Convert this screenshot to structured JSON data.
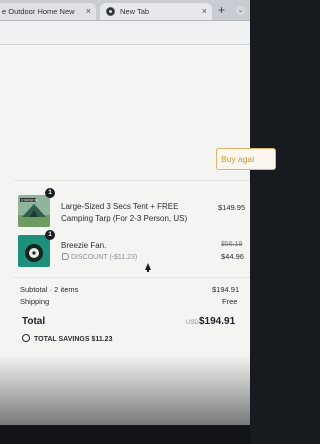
{
  "browser": {
    "tabs": [
      {
        "title": "e Outdoor Home New",
        "close": "×"
      },
      {
        "title": "New Tab",
        "close": "×"
      }
    ],
    "new_tab": "+",
    "menu": "⌄"
  },
  "page": {
    "buy_again": "Buy agai",
    "items": [
      {
        "name": "Large-Sized 3 Secs Tent + FREE Camping Tarp (For 2-3 Person, US)",
        "quantity": "1",
        "price": "$149.95",
        "thumb_label": "STARSON"
      },
      {
        "name": "Breezie Fan.",
        "quantity": "1",
        "original_price": "$56.19",
        "price": "$44.96",
        "discount": "DISCOUNT (-$11.23)"
      }
    ],
    "summary": {
      "subtotal_label": "Subtotal · 2 items",
      "subtotal_value": "$194.91",
      "shipping_label": "Shipping",
      "shipping_value": "Free",
      "total_label": "Total",
      "total_currency": "USD",
      "total_value": "$194.91",
      "savings": "TOTAL SAVINGS $11.23"
    }
  }
}
